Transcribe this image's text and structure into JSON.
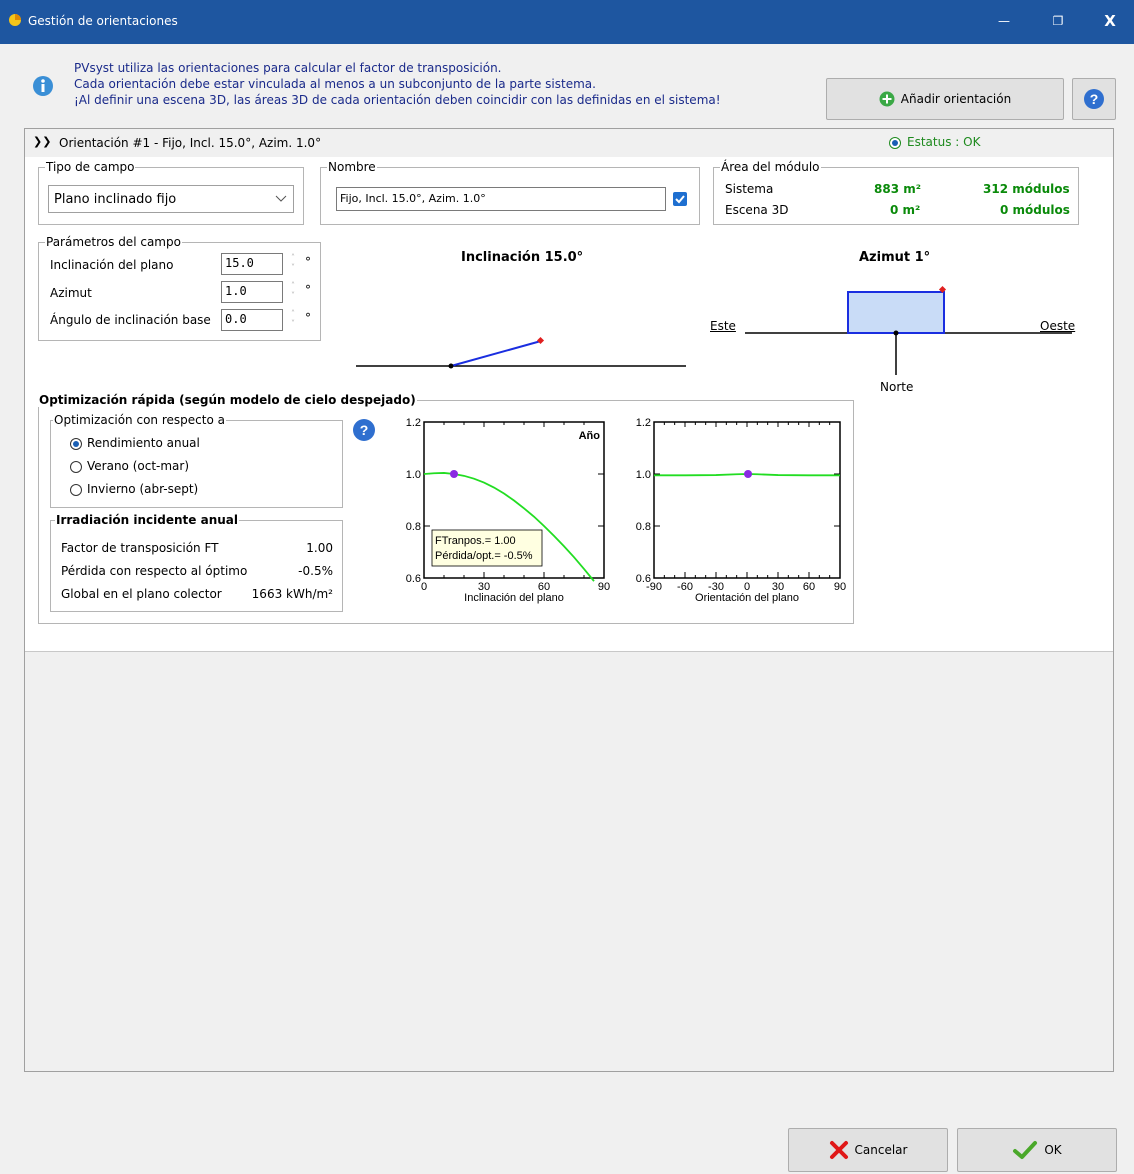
{
  "window": {
    "title": "Gestión de orientaciones",
    "controls": [
      "—",
      "❐",
      "X"
    ]
  },
  "info": {
    "lines": [
      "PVsyst utiliza las orientaciones para calcular el factor de transposición.",
      "Cada orientación debe estar vinculada al menos a un subconjunto de la parte sistema.",
      "¡Al definir una escena 3D, las áreas 3D de cada orientación deben coincidir con las definidas en el sistema!"
    ],
    "add_button": "Añadir orientación"
  },
  "orientation": {
    "header": "Orientación #1 - Fijo, Incl. 15.0°, Azim. 1.0°",
    "status": "Estatus : OK",
    "field_type": {
      "legend": "Tipo de campo",
      "value": "Plano inclinado fijo"
    },
    "name": {
      "legend": "Nombre",
      "value": "Fijo, Incl. 15.0°, Azim. 1.0°",
      "checked": true
    },
    "module_area": {
      "legend": "Área del módulo",
      "rows": [
        {
          "label": "Sistema",
          "area": "883 m²",
          "modules": "312 módulos"
        },
        {
          "label": "Escena 3D",
          "area": "0 m²",
          "modules": "0 módulos"
        }
      ]
    },
    "params": {
      "legend": "Parámetros del campo",
      "rows": [
        {
          "label": "Inclinación del plano",
          "value": "15.0",
          "unit": "°"
        },
        {
          "label": "Azimut",
          "value": "1.0",
          "unit": "°"
        },
        {
          "label": "Ángulo de inclinación base",
          "value": "0.0",
          "unit": "°"
        }
      ]
    },
    "tilt_diagram": {
      "title": "Inclinación 15.0°"
    },
    "azimuth_diagram": {
      "title": "Azimut 1°",
      "east": "Este",
      "west": "Oeste",
      "north": "Norte"
    },
    "optimization": {
      "legend": "Optimización rápida (según modelo de cielo despejado)",
      "wrt_legend": "Optimización con respecto a",
      "options": [
        "Rendimiento anual",
        "Verano (oct-mar)",
        "Invierno (abr-sept)"
      ],
      "selected": 0,
      "irradiation": {
        "legend": "Irradiación incidente anual",
        "rows": [
          {
            "label": "Factor de transposición FT",
            "value": "1.00"
          },
          {
            "label": "Pérdida con respecto al óptimo",
            "value": "-0.5%"
          },
          {
            "label": "Global en el plano colector",
            "value": "1663 kWh/m²"
          }
        ]
      }
    }
  },
  "chart_data": [
    {
      "type": "line",
      "title": "Año",
      "xlabel": "Inclinación del plano",
      "ylabel": "",
      "xlim": [
        0,
        90
      ],
      "ylim": [
        0.6,
        1.2
      ],
      "xticks": [
        "0",
        "30",
        "60",
        "90"
      ],
      "yticks": [
        "0.6",
        "0.8",
        "1.0",
        "1.2"
      ],
      "series": [
        {
          "color": "#22dd22",
          "x": [
            0,
            5,
            10,
            15,
            20,
            25,
            30,
            35,
            40,
            45,
            50,
            55,
            60,
            65,
            70,
            75,
            80,
            85
          ],
          "y": [
            1.0,
            1.003,
            1.004,
            1.0,
            0.993,
            0.982,
            0.967,
            0.948,
            0.925,
            0.898,
            0.868,
            0.836,
            0.8,
            0.762,
            0.722,
            0.68,
            0.635,
            0.588
          ]
        }
      ],
      "marker": {
        "x": 15,
        "y": 1.0,
        "color": "#8a2be2"
      },
      "tooltip": [
        "FTranpos.= 1.00",
        "Pérdida/opt.= -0.5%"
      ]
    },
    {
      "type": "line",
      "title": "",
      "xlabel": "Orientación del plano",
      "ylabel": "",
      "xlim": [
        -90,
        90
      ],
      "ylim": [
        0.6,
        1.2
      ],
      "xticks": [
        "-90",
        "-60",
        "-30",
        "0",
        "30",
        "60",
        "90"
      ],
      "yticks": [
        "0.6",
        "0.8",
        "1.0",
        "1.2"
      ],
      "series": [
        {
          "color": "#22dd22",
          "x": [
            -90,
            -60,
            -30,
            -10,
            0,
            10,
            30,
            60,
            90
          ],
          "y": [
            0.995,
            0.995,
            0.996,
            0.999,
            1.0,
            0.999,
            0.996,
            0.995,
            0.995
          ]
        }
      ],
      "marker": {
        "x": 1,
        "y": 1.0,
        "color": "#8a2be2"
      }
    }
  ],
  "footer": {
    "cancel": "Cancelar",
    "ok": "OK"
  }
}
